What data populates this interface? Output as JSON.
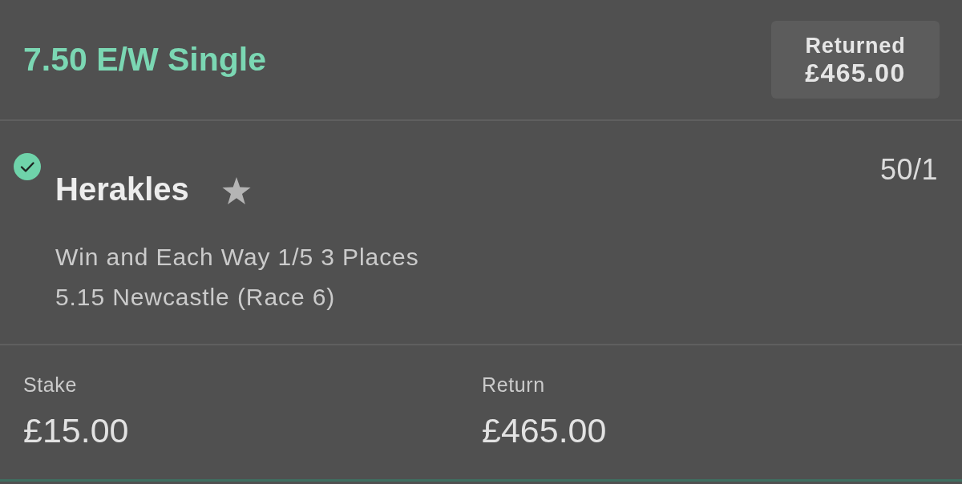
{
  "bet": {
    "title": "7.50 E/W Single",
    "status": {
      "label": "Returned",
      "amount": "£465.00"
    }
  },
  "selection": {
    "won": true,
    "name": "Herakles",
    "odds": "50/1",
    "market": "Win and Each Way 1/5 3 Places",
    "event": "5.15 Newcastle (Race 6)"
  },
  "totals": [
    {
      "label": "Stake",
      "value": "£15.00"
    },
    {
      "label": "Return",
      "value": "£465.00"
    }
  ]
}
